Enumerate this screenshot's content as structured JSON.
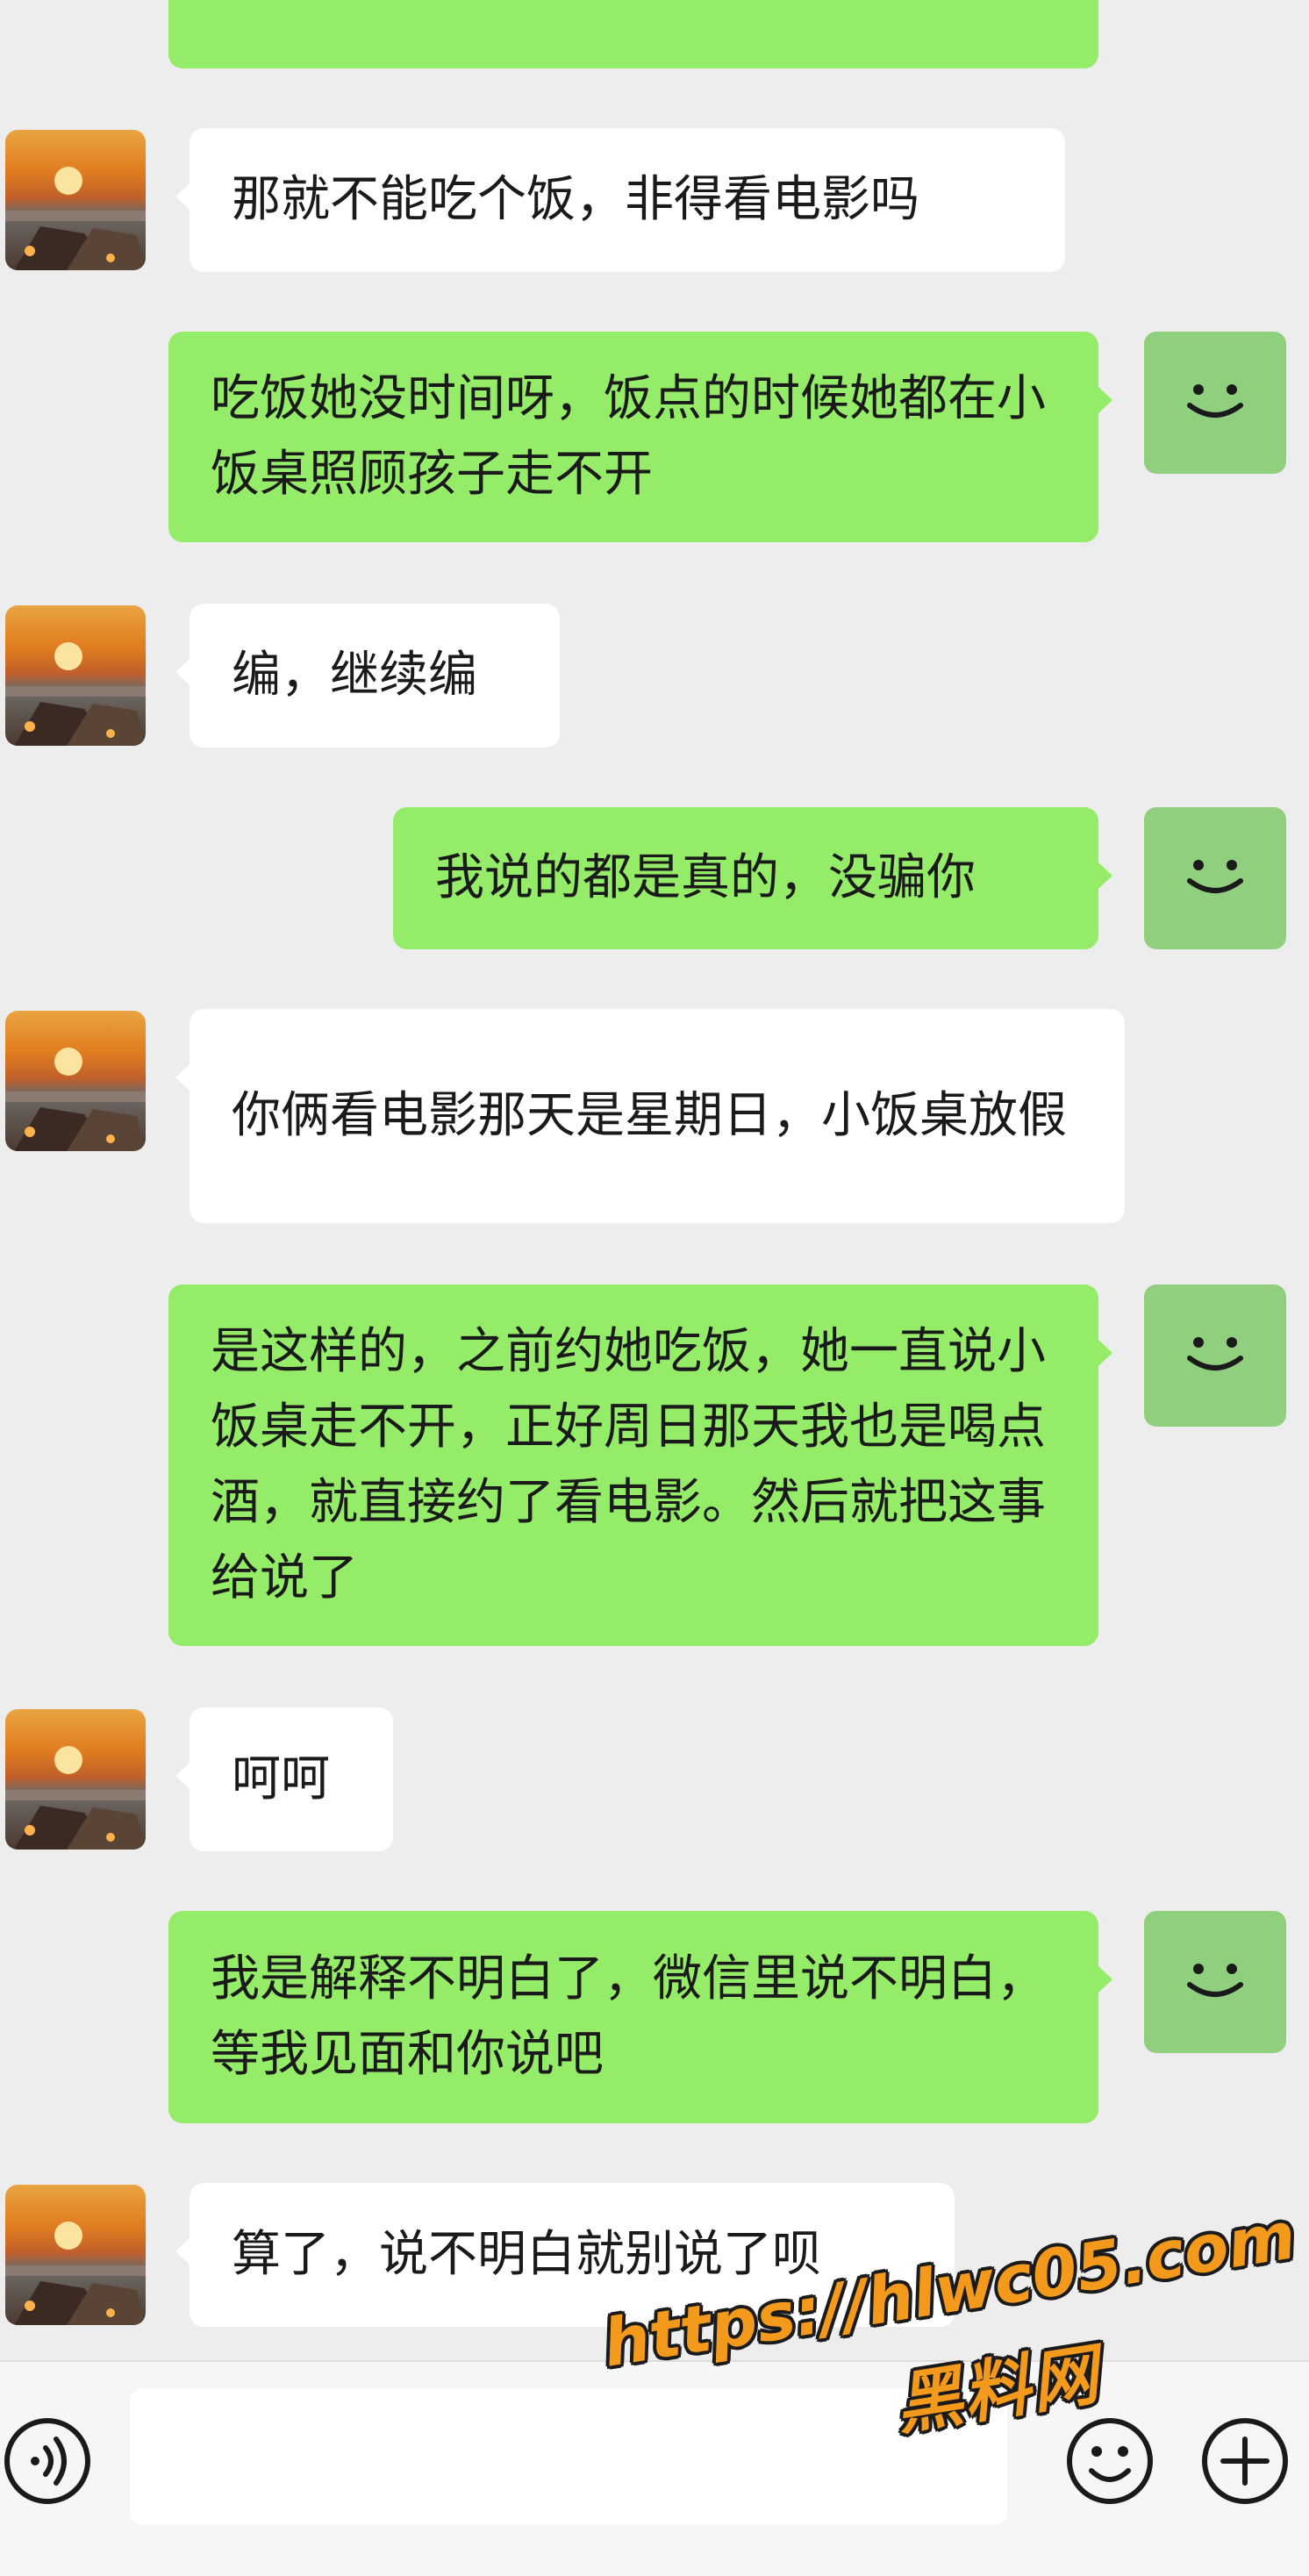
{
  "chat": {
    "messages": [
      {
        "side": "out",
        "text": ""
      },
      {
        "side": "in",
        "text": "那就不能吃个饭，非得看电影吗"
      },
      {
        "side": "out",
        "text": "吃饭她没时间呀，饭点的时候她都在小饭桌照顾孩子走不开"
      },
      {
        "side": "in",
        "text": "编，继续编"
      },
      {
        "side": "out",
        "text": "我说的都是真的，没骗你"
      },
      {
        "side": "in",
        "text": "你俩看电影那天是星期日，小饭桌放假"
      },
      {
        "side": "out",
        "text": "是这样的，之前约她吃饭，她一直说小饭桌走不开，正好周日那天我也是喝点酒，就直接约了看电影。然后就把这事给说了"
      },
      {
        "side": "in",
        "text": "呵呵"
      },
      {
        "side": "out",
        "text": "我是解释不明白了，微信里说不明白，等我见面和你说吧"
      },
      {
        "side": "in",
        "text": "算了，说不明白就别说了呗"
      }
    ]
  },
  "input_bar": {
    "voice_icon": "voice-icon",
    "emoji_icon": "emoji-icon",
    "plus_icon": "plus-icon",
    "input_value": ""
  },
  "watermark": {
    "url": "https://hlwc05.com",
    "name": "黑料网"
  },
  "colors": {
    "background": "#ededed",
    "incoming_bubble": "#ffffff",
    "outgoing_bubble": "#95ec69",
    "watermark": "#f39a1c"
  }
}
